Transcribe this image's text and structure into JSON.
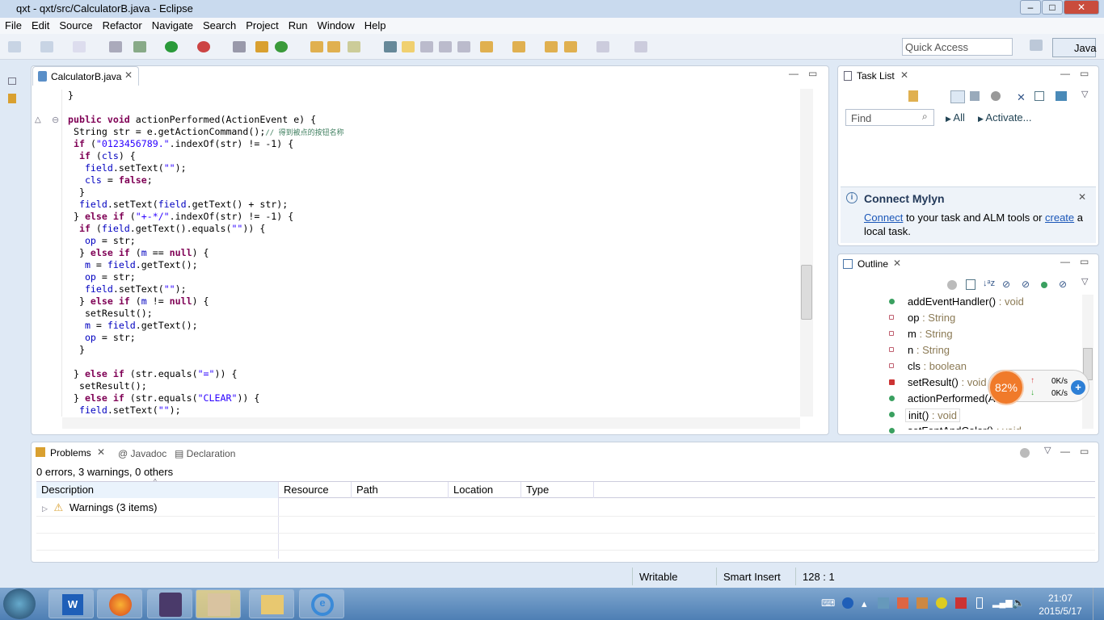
{
  "window": {
    "title": "qxt - qxt/src/CalculatorB.java - Eclipse"
  },
  "menu": [
    "File",
    "Edit",
    "Source",
    "Refactor",
    "Navigate",
    "Search",
    "Project",
    "Run",
    "Window",
    "Help"
  ],
  "quick_access": {
    "placeholder": "Quick Access"
  },
  "perspective": "Java",
  "editor": {
    "tab": "CalculatorB.java",
    "lines": [
      [
        [
          "}",
          ""
        ]
      ],
      [],
      [
        [
          "public void ",
          "k"
        ],
        [
          "actionPerformed(ActionEvent e) {",
          ""
        ]
      ],
      [
        [
          " String str = e.getActionCommand();",
          ""
        ],
        [
          "// 得到被点的按钮名称",
          "c"
        ]
      ],
      [
        [
          " ",
          "k"
        ],
        [
          "if ",
          "k"
        ],
        [
          "(",
          ""
        ],
        [
          "\"0123456789.\"",
          "s"
        ],
        [
          ".indexOf(str) != -1) {",
          ""
        ]
      ],
      [
        [
          "  if ",
          "k"
        ],
        [
          "(",
          ""
        ],
        [
          "cls",
          "f"
        ],
        [
          ") {",
          ""
        ]
      ],
      [
        [
          "   ",
          ""
        ],
        [
          "field",
          "f"
        ],
        [
          ".setText(",
          ""
        ],
        [
          "\"\"",
          "s"
        ],
        [
          ");",
          ""
        ]
      ],
      [
        [
          "   ",
          ""
        ],
        [
          "cls",
          "f"
        ],
        [
          " = ",
          ""
        ],
        [
          "false",
          "k"
        ],
        [
          ";",
          ""
        ]
      ],
      [
        [
          "  }",
          ""
        ]
      ],
      [
        [
          "  ",
          ""
        ],
        [
          "field",
          "f"
        ],
        [
          ".setText(",
          ""
        ],
        [
          "field",
          "f"
        ],
        [
          ".getText() + str);",
          ""
        ]
      ],
      [
        [
          " } ",
          ""
        ],
        [
          "else if ",
          "k"
        ],
        [
          "(",
          ""
        ],
        [
          "\"+-*/\"",
          "s"
        ],
        [
          ".indexOf(str) != -1) {",
          ""
        ]
      ],
      [
        [
          "  if ",
          "k"
        ],
        [
          "(",
          ""
        ],
        [
          "field",
          "f"
        ],
        [
          ".getText().equals(",
          ""
        ],
        [
          "\"\"",
          "s"
        ],
        [
          ")) {",
          ""
        ]
      ],
      [
        [
          "   ",
          ""
        ],
        [
          "op",
          "f"
        ],
        [
          " = str;",
          ""
        ]
      ],
      [
        [
          "  } ",
          ""
        ],
        [
          "else if ",
          "k"
        ],
        [
          "(",
          ""
        ],
        [
          "m",
          "f"
        ],
        [
          " == ",
          ""
        ],
        [
          "null",
          "k"
        ],
        [
          ") {",
          ""
        ]
      ],
      [
        [
          "   ",
          ""
        ],
        [
          "m",
          "f"
        ],
        [
          " = ",
          ""
        ],
        [
          "field",
          "f"
        ],
        [
          ".getText();",
          ""
        ]
      ],
      [
        [
          "   ",
          ""
        ],
        [
          "op",
          "f"
        ],
        [
          " = str;",
          ""
        ]
      ],
      [
        [
          "   ",
          ""
        ],
        [
          "field",
          "f"
        ],
        [
          ".setText(",
          ""
        ],
        [
          "\"\"",
          "s"
        ],
        [
          ");",
          ""
        ]
      ],
      [
        [
          "  } ",
          ""
        ],
        [
          "else if ",
          "k"
        ],
        [
          "(",
          ""
        ],
        [
          "m",
          "f"
        ],
        [
          " != ",
          ""
        ],
        [
          "null",
          "k"
        ],
        [
          ") {",
          ""
        ]
      ],
      [
        [
          "   setResult();",
          ""
        ]
      ],
      [
        [
          "   ",
          ""
        ],
        [
          "m",
          "f"
        ],
        [
          " = ",
          ""
        ],
        [
          "field",
          "f"
        ],
        [
          ".getText();",
          ""
        ]
      ],
      [
        [
          "   ",
          ""
        ],
        [
          "op",
          "f"
        ],
        [
          " = str;",
          ""
        ]
      ],
      [
        [
          "  }",
          ""
        ]
      ],
      [],
      [
        [
          " } ",
          ""
        ],
        [
          "else if ",
          "k"
        ],
        [
          "(str.equals(",
          ""
        ],
        [
          "\"=\"",
          "s"
        ],
        [
          ")) {",
          ""
        ]
      ],
      [
        [
          "  setResult();",
          ""
        ]
      ],
      [
        [
          " } ",
          ""
        ],
        [
          "else if ",
          "k"
        ],
        [
          "(str.equals(",
          ""
        ],
        [
          "\"CLEAR\"",
          "s"
        ],
        [
          ")) {",
          ""
        ]
      ],
      [
        [
          "  ",
          ""
        ],
        [
          "field",
          "f"
        ],
        [
          ".setText(",
          ""
        ],
        [
          "\"\"",
          "s"
        ],
        [
          ");",
          ""
        ]
      ]
    ]
  },
  "tasklist": {
    "tab": "Task List",
    "find_placeholder": "Find",
    "all": "All",
    "activate": "Activate...",
    "mylyn_title": "Connect Mylyn",
    "mylyn_link1": "Connect",
    "mylyn_mid": " to your task and ALM tools or ",
    "mylyn_link2": "create",
    "mylyn_end": " a local task."
  },
  "outline": {
    "tab": "Outline",
    "items": [
      {
        "name": "addEventHandler()",
        "type": " : void",
        "kind": "public-method"
      },
      {
        "name": "op",
        "type": " : String",
        "kind": "field"
      },
      {
        "name": "m",
        "type": " : String",
        "kind": "field"
      },
      {
        "name": "n",
        "type": " : String",
        "kind": "field"
      },
      {
        "name": "cls",
        "type": " : boolean",
        "kind": "field"
      },
      {
        "name": "setResult()",
        "type": " : void",
        "kind": "private-method"
      },
      {
        "name": "actionPerformed(A",
        "type": "",
        "kind": "public-method"
      },
      {
        "name": "init()",
        "type": " : void",
        "kind": "public-method"
      },
      {
        "name": "setFontAndColor()",
        "type": " : void",
        "kind": "public-method"
      }
    ]
  },
  "net_widget": {
    "percent": "82%",
    "up": "0K/s",
    "down": "0K/s"
  },
  "problems": {
    "tabs": [
      "Problems",
      "Javadoc",
      "Declaration"
    ],
    "summary": "0 errors, 3 warnings, 0 others",
    "columns": [
      "Description",
      "Resource",
      "Path",
      "Location",
      "Type"
    ],
    "rows": [
      {
        "description": "Warnings (3 items)"
      }
    ]
  },
  "status": {
    "writable": "Writable",
    "insert": "Smart Insert",
    "position": "128 : 1"
  },
  "clock": {
    "time": "21:07",
    "date": "2015/5/17"
  }
}
